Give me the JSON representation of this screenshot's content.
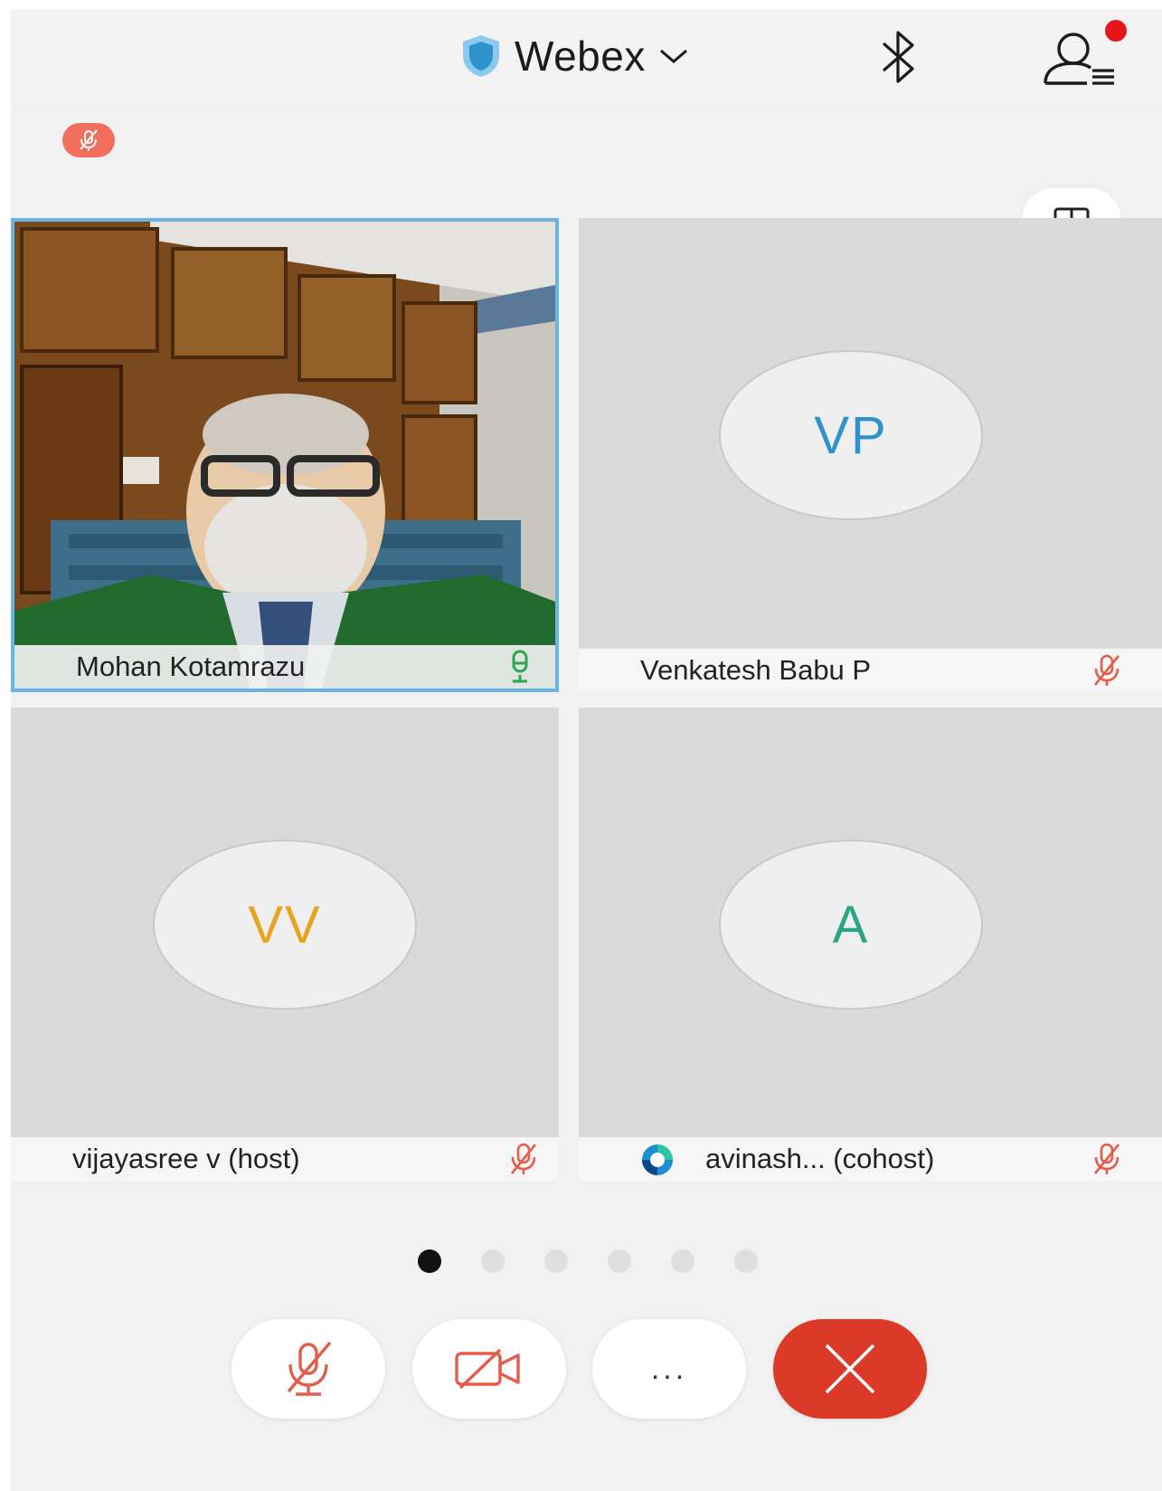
{
  "header": {
    "app_title": "Webex",
    "shield_icon": "shield-icon",
    "chevron_icon": "chevron-down-icon",
    "bluetooth_icon": "bluetooth-icon",
    "participants_icon": "participants-icon",
    "notification": true
  },
  "self_status": {
    "icon": "muted-mic-icon"
  },
  "layout_toggle": {
    "icon": "grid-layout-icon"
  },
  "tiles": [
    {
      "name": "Mohan Kotamrazu",
      "video": true,
      "active_speaker": true,
      "mic": "unmuted"
    },
    {
      "name": "Venkatesh Babu P",
      "initials": "VP",
      "initials_color": "#2e93cc",
      "mic": "muted"
    },
    {
      "name": "vijayasree v (host)",
      "initials": "VV",
      "initials_color": "#e8a41f",
      "mic": "muted"
    },
    {
      "name": "avinash... (cohost)",
      "initials": "A",
      "initials_color": "#27a585",
      "mic": "muted",
      "app_icon": "webex-app-icon"
    }
  ],
  "pagination": {
    "pages": 6,
    "current": 1
  },
  "controls": {
    "mute_icon": "muted-mic-icon",
    "video_icon": "video-off-icon",
    "more_label": "...",
    "end_icon": "close-icon"
  },
  "colors": {
    "accent_blue": "#2e93cc",
    "mute_red": "#e35d4a",
    "end_red": "#da3a27",
    "mic_green": "#2ca84a",
    "active_border": "#6bb3e0"
  }
}
